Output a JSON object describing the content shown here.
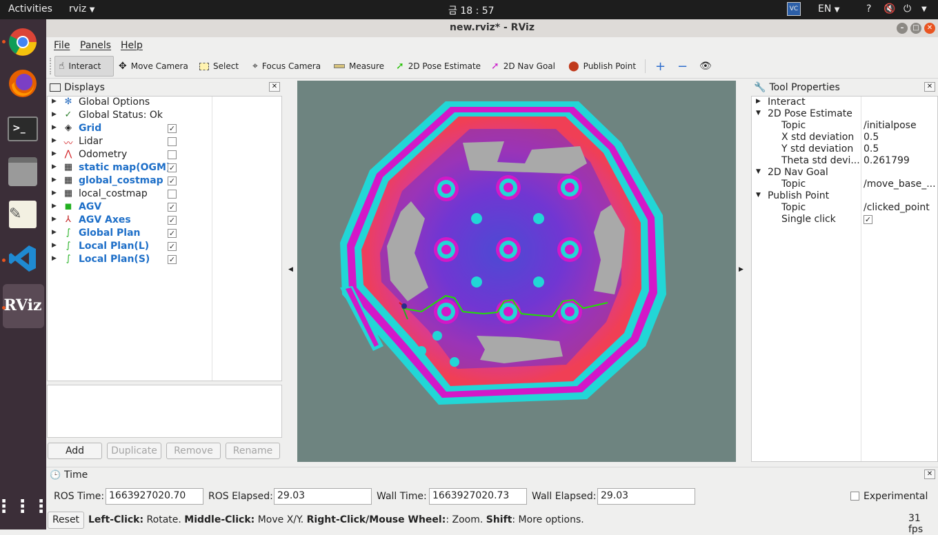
{
  "topbar": {
    "activities": "Activities",
    "app_name": "rviz",
    "clock": "금 18 : 57",
    "lang": "EN",
    "help": "?"
  },
  "dock": {
    "rviz_label": "RViz"
  },
  "window": {
    "title": "new.rviz* - RViz"
  },
  "menu": {
    "file": "File",
    "panels": "Panels",
    "help": "Help"
  },
  "toolbar": {
    "interact": "Interact",
    "move_camera": "Move Camera",
    "select": "Select",
    "focus_camera": "Focus Camera",
    "measure": "Measure",
    "pose_estimate": "2D Pose Estimate",
    "nav_goal": "2D Nav Goal",
    "publish_point": "Publish Point"
  },
  "displays": {
    "title": "Displays",
    "items": [
      {
        "label": "Global Options",
        "checked": null,
        "bold": false
      },
      {
        "label": "Global Status: Ok",
        "checked": null,
        "bold": false
      },
      {
        "label": "Grid",
        "checked": true,
        "bold": true
      },
      {
        "label": "Lidar",
        "checked": false,
        "bold": false
      },
      {
        "label": "Odometry",
        "checked": false,
        "bold": false
      },
      {
        "label": "static map(OGM)",
        "checked": true,
        "bold": true
      },
      {
        "label": "global_costmap",
        "checked": true,
        "bold": true
      },
      {
        "label": "local_costmap",
        "checked": false,
        "bold": false
      },
      {
        "label": "AGV",
        "checked": true,
        "bold": true
      },
      {
        "label": "AGV Axes",
        "checked": true,
        "bold": true
      },
      {
        "label": "Global Plan",
        "checked": true,
        "bold": true
      },
      {
        "label": "Local Plan(L)",
        "checked": true,
        "bold": true
      },
      {
        "label": "Local Plan(S)",
        "checked": true,
        "bold": true
      }
    ],
    "buttons": {
      "add": "Add",
      "duplicate": "Duplicate",
      "remove": "Remove",
      "rename": "Rename"
    }
  },
  "tool_properties": {
    "title": "Tool Properties",
    "interact": "Interact",
    "pose_estimate": "2D Pose Estimate",
    "pose_topic_k": "Topic",
    "pose_topic_v": "/initialpose",
    "x_std_k": "X std deviation",
    "x_std_v": "0.5",
    "y_std_k": "Y std deviation",
    "y_std_v": "0.5",
    "theta_k": "Theta std devi...",
    "theta_v": "0.261799",
    "nav_goal": "2D Nav Goal",
    "nav_topic_k": "Topic",
    "nav_topic_v": "/move_base_...",
    "publish_point": "Publish Point",
    "pp_topic_k": "Topic",
    "pp_topic_v": "/clicked_point",
    "single_click_k": "Single click"
  },
  "time": {
    "title": "Time",
    "ros_time_label": "ROS Time:",
    "ros_time": "1663927020.70",
    "ros_elapsed_label": "ROS Elapsed:",
    "ros_elapsed": "29.03",
    "wall_time_label": "Wall Time:",
    "wall_time": "1663927020.73",
    "wall_elapsed_label": "Wall Elapsed:",
    "wall_elapsed": "29.03",
    "experimental": "Experimental"
  },
  "status": {
    "reset": "Reset",
    "lc": "Left-Click:",
    "lc_t": " Rotate. ",
    "mc": "Middle-Click:",
    "mc_t": " Move X/Y. ",
    "rc": "Right-Click/Mouse Wheel:",
    "rc_t": ": Zoom. ",
    "sh": "Shift",
    "sh_t": ": More options.",
    "fps": "31 fps"
  },
  "colors": {
    "map_bg": "#6e8480",
    "inflation_outer": "#22d6d6",
    "inflation_inner": "#d318c8",
    "free": "#a9a9a9",
    "path": "#22e000"
  }
}
